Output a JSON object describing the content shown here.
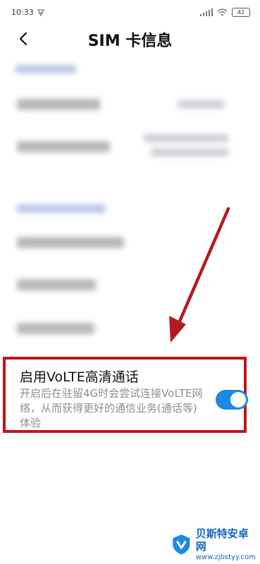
{
  "status_bar": {
    "time": "10:33",
    "battery": "42"
  },
  "header": {
    "title": "SIM 卡信息"
  },
  "volte": {
    "title": "启用VoLTE高清通话",
    "description": "开启后在驻留4G时会尝试连接VoLTE网络，从而获得更好的通信业务(通话等)体验",
    "enabled": true
  },
  "watermark": {
    "name": "贝斯特安卓网",
    "url": "www.zjbstyy.com"
  },
  "colors": {
    "accent": "#1e88e5",
    "highlight_border": "#c4121c",
    "arrow": "#b31b22"
  }
}
